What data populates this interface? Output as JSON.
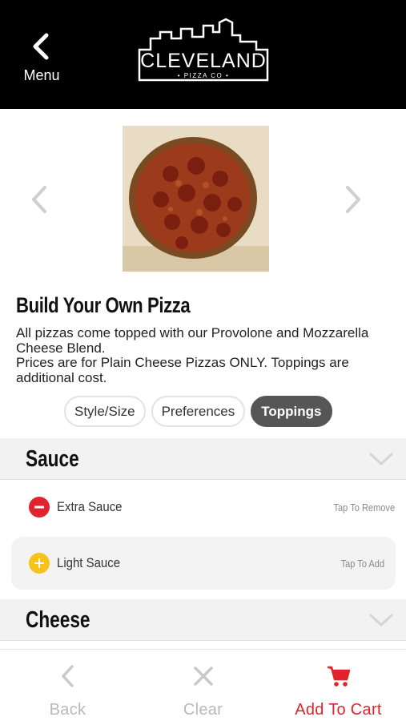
{
  "header": {
    "menu_label": "Menu",
    "brand": "CLEVELAND",
    "brand_sub": "• PIZZA CO •"
  },
  "product": {
    "title": "Build Your Own Pizza",
    "description_line1": "All pizzas come topped with our Provolone and Mozzarella Cheese Blend.",
    "description_line2": "Prices are for Plain Cheese Pizzas ONLY. Toppings are additional cost."
  },
  "tabs": [
    {
      "label": "Style/Size",
      "active": false
    },
    {
      "label": "Preferences",
      "active": false
    },
    {
      "label": "Toppings",
      "active": true
    }
  ],
  "sections": {
    "sauce": {
      "title": "Sauce",
      "items": [
        {
          "label": "Extra Sauce",
          "hint": "Tap To Remove",
          "state": "selected"
        },
        {
          "label": "Light Sauce",
          "hint": "Tap To Add",
          "state": "unselected"
        }
      ]
    },
    "cheese": {
      "title": "Cheese"
    }
  },
  "bottom_bar": {
    "back_label": "Back",
    "clear_label": "Clear",
    "add_to_cart_label": "Add To Cart"
  },
  "colors": {
    "accent_red": "#e0232c",
    "add_yellow": "#f6c31b",
    "header_black": "#000000",
    "active_tab": "#565656"
  },
  "icons": {
    "back": "chevron-left-icon",
    "carousel_prev": "chevron-left-icon",
    "carousel_next": "chevron-right-icon",
    "remove": "minus-circle-icon",
    "add": "plus-circle-icon",
    "clear": "close-icon",
    "cart": "shopping-cart-icon"
  }
}
